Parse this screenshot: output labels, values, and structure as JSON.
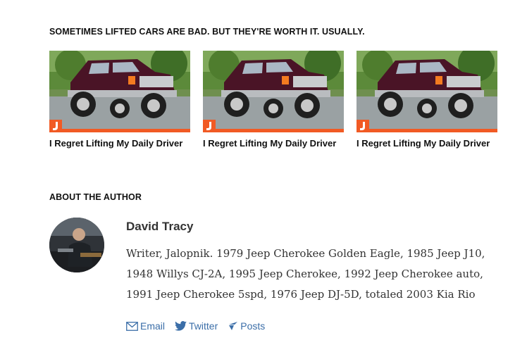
{
  "related": {
    "heading": "SOMETIMES LIFTED CARS ARE BAD. BUT THEY'RE WORTH IT. USUALLY.",
    "cards": [
      {
        "title": "I Regret Lifting My Daily Driver",
        "badge_icon": "jalopnik-logo-icon"
      },
      {
        "title": "I Regret Lifting My Daily Driver",
        "badge_icon": "jalopnik-logo-icon"
      },
      {
        "title": "I Regret Lifting My Daily Driver",
        "badge_icon": "jalopnik-logo-icon"
      }
    ],
    "accent_color": "#f15a24"
  },
  "author": {
    "heading": "ABOUT THE AUTHOR",
    "name": "David Tracy",
    "bio": "Writer, Jalopnik. 1979 Jeep Cherokee Golden Eagle, 1985 Jeep J10, 1948 Willys CJ-2A, 1995 Jeep Cherokee, 1992 Jeep Cherokee auto, 1991 Jeep Cherokee 5spd, 1976 Jeep DJ-5D, totaled 2003 Kia Rio",
    "links": [
      {
        "label": "Email",
        "icon": "envelope-icon"
      },
      {
        "label": "Twitter",
        "icon": "twitter-bird-icon"
      },
      {
        "label": "Posts",
        "icon": "kinja-posts-icon"
      }
    ],
    "link_color": "#3b6ea8"
  }
}
